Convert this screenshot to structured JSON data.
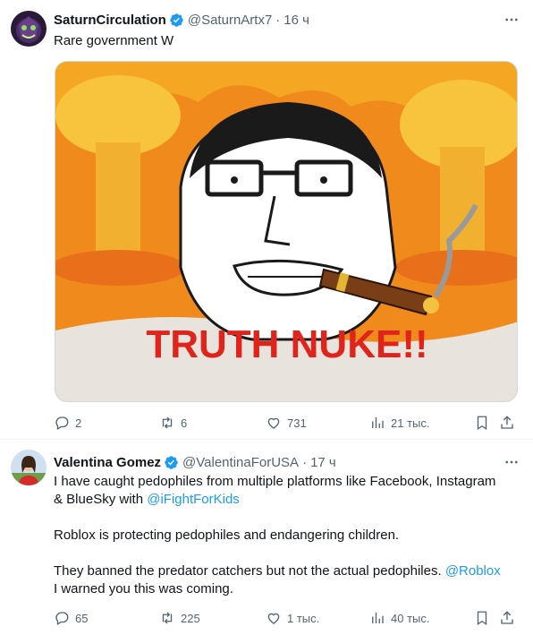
{
  "tweets": [
    {
      "name": "SaturnCirculation",
      "handle": "@SaturnArtx7",
      "separator": "·",
      "time": "16 ч",
      "text": "Rare government W",
      "image_text": "TRUTH NUKE!!",
      "actions": {
        "replies": "2",
        "retweets": "6",
        "likes": "731",
        "views": "21 тыс."
      }
    },
    {
      "name": "Valentina Gomez",
      "handle": "@ValentinaForUSA",
      "separator": "·",
      "time": "17 ч",
      "line1": "I have caught pedophiles from multiple platforms like Facebook, Instagram",
      "line2_prefix": "& BlueSky with ",
      "mention1": "@iFightForKids",
      "para2": "Roblox is protecting pedophiles and endangering children.",
      "para3_prefix": "They banned the predator catchers but not the actual pedophiles. ",
      "mention2": "@Roblox",
      "para3_line2": "I warned you this was coming.",
      "actions": {
        "replies": "65",
        "retweets": "225",
        "likes": "1 тыс.",
        "views": "40 тыс."
      }
    }
  ],
  "colors": {
    "verified": "#1d9bf0",
    "link": "#1d9bf0",
    "muted": "#536471",
    "meme_bg": "#f08a1c",
    "meme_text": "#e0241c"
  }
}
